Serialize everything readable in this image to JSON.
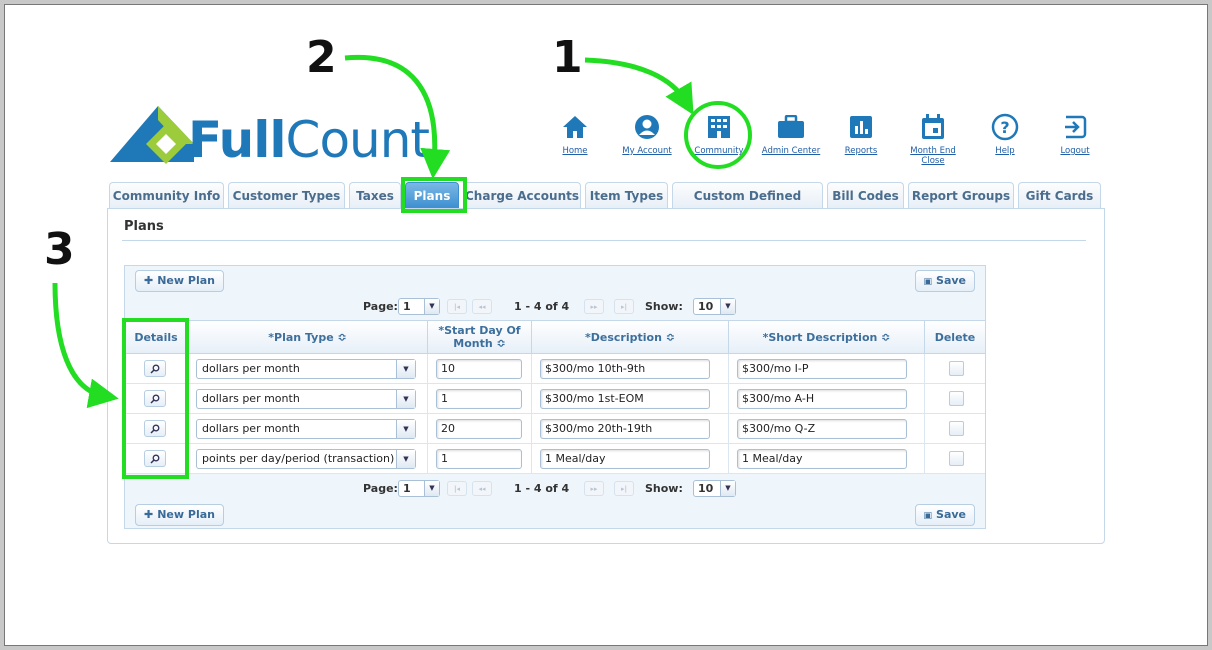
{
  "brand": {
    "logo_prefix": "F",
    "logo_bold": "ull",
    "logo_rest": "Count",
    "color": "#1f79b8",
    "accent": "#9ccc3c"
  },
  "nav": [
    {
      "label": "Home",
      "icon": "home-icon"
    },
    {
      "label": "My Account",
      "icon": "account-icon"
    },
    {
      "label": "Community",
      "icon": "building-icon"
    },
    {
      "label": "Admin Center",
      "icon": "briefcase-icon"
    },
    {
      "label": "Reports",
      "icon": "chart-icon"
    },
    {
      "label": "Month End Close",
      "icon": "calendar-icon"
    },
    {
      "label": "Help",
      "icon": "help-icon"
    },
    {
      "label": "Logout",
      "icon": "logout-icon"
    }
  ],
  "tabs": [
    "Community Info",
    "Customer Types",
    "Taxes",
    "Plans",
    "Charge Accounts",
    "Item Types",
    "Custom Defined Fields",
    "Bill Codes",
    "Report Groups",
    "Gift Cards"
  ],
  "active_tab": "Plans",
  "page_title": "Plans",
  "toolbar": {
    "new_plan": "New Plan",
    "save": "Save"
  },
  "pager": {
    "page_label": "Page:",
    "page_value": "1",
    "range": "1 - 4 of 4",
    "show_label": "Show:",
    "show_value": "10"
  },
  "columns": {
    "details": "Details",
    "plan_type": "*Plan Type ≎",
    "start_day": "*Start Day Of Month ≎",
    "description": "*Description ≎",
    "short_description": "*Short Description ≎",
    "delete": "Delete"
  },
  "rows": [
    {
      "plan_type": "dollars per month",
      "start_day": "10",
      "description": "$300/mo 10th-9th",
      "short_description": "$300/mo I-P"
    },
    {
      "plan_type": "dollars per month",
      "start_day": "1",
      "description": "$300/mo 1st-EOM",
      "short_description": "$300/mo A-H"
    },
    {
      "plan_type": "dollars per month",
      "start_day": "20",
      "description": "$300/mo 20th-19th",
      "short_description": "$300/mo Q-Z"
    },
    {
      "plan_type": "points per day/period (transaction)",
      "start_day": "1",
      "description": "1 Meal/day",
      "short_description": "1 Meal/day"
    }
  ],
  "annotations": {
    "n1": "1",
    "n2": "2",
    "n3": "3",
    "highlight_color": "#22dd22"
  }
}
